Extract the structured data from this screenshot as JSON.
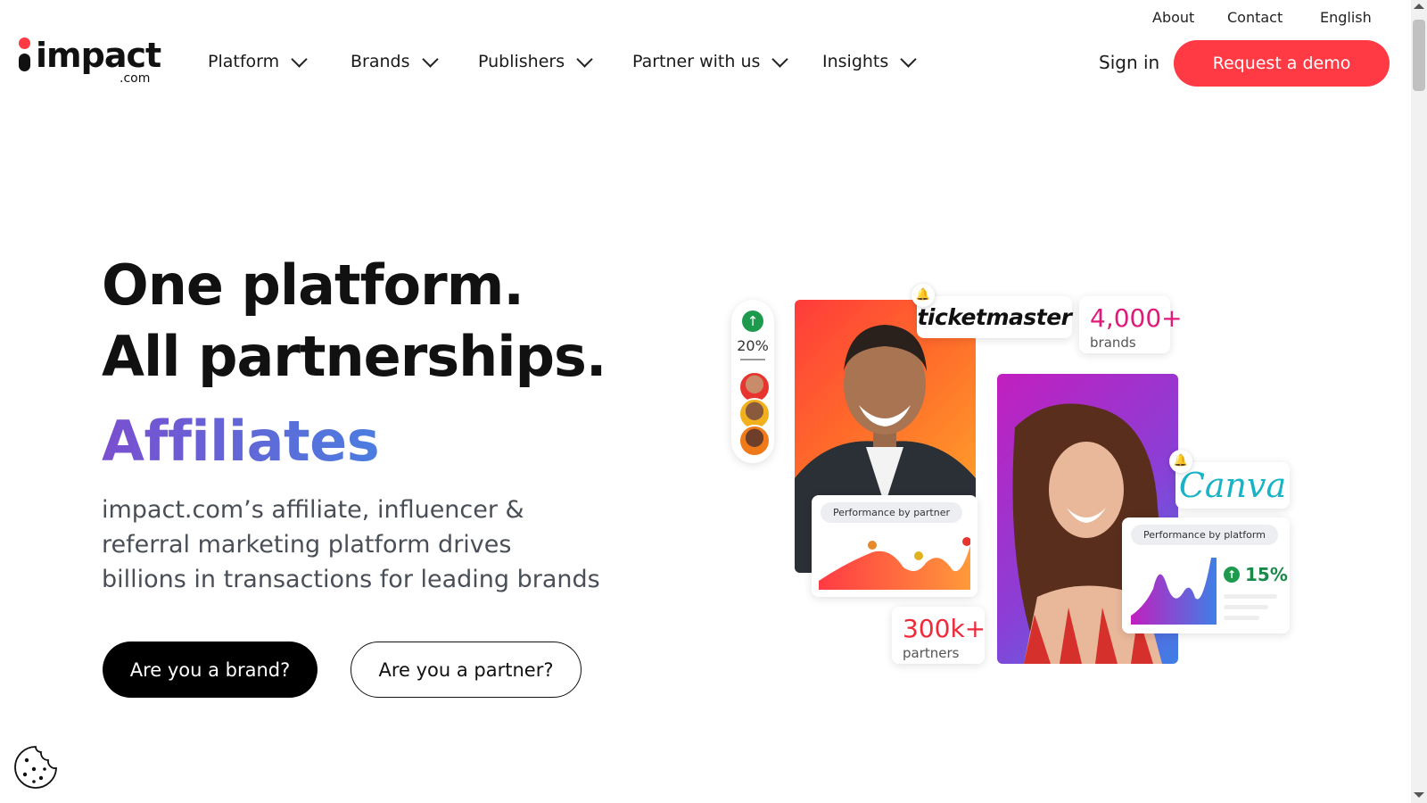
{
  "utility_nav": {
    "about": "About",
    "contact": "Contact",
    "language": "English"
  },
  "logo": {
    "word": "impact",
    "suffix": ".com"
  },
  "nav": [
    {
      "label": "Platform"
    },
    {
      "label": "Brands"
    },
    {
      "label": "Publishers"
    },
    {
      "label": "Partner with us"
    },
    {
      "label": "Insights"
    }
  ],
  "header": {
    "sign_in": "Sign in",
    "request_demo": "Request a demo"
  },
  "hero": {
    "headline_line1": "One platform.",
    "headline_line2": "All partnerships.",
    "rotating_word": "Affiliates",
    "description": "impact.com’s affiliate, influencer & referral marketing platform drives billions in transactions for leading brands",
    "cta_brand": "Are you a brand?",
    "cta_partner": "Are you a partner?"
  },
  "visual": {
    "pill_percent": "20%",
    "ticketmaster": "ticketmaster",
    "brands_count": "4,000+",
    "brands_label": "brands",
    "canva": "Canva",
    "perf_partner": "Performance by partner",
    "perf_platform": "Performance by platform",
    "platform_change": "15%",
    "partners_count": "300k+",
    "partners_label": "partners"
  },
  "colors": {
    "accent": "#ff3a44",
    "text": "#111111",
    "muted": "#4a4f57",
    "positive": "#1e9a4e"
  }
}
